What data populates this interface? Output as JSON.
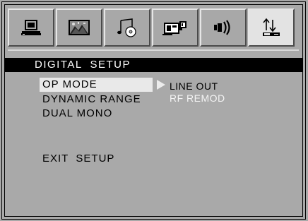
{
  "tabs": [
    {
      "icon": "monitor-icon",
      "active": false
    },
    {
      "icon": "picture-icon",
      "active": false
    },
    {
      "icon": "music-cd-icon",
      "active": false
    },
    {
      "icon": "video-camera-icon",
      "active": false
    },
    {
      "icon": "speaker-icon",
      "active": false
    },
    {
      "icon": "digital-setup-icon",
      "active": true
    }
  ],
  "title": "DIGITAL  SETUP",
  "menu": {
    "op_mode": "OP MODE",
    "dynamic_range": "DYNAMIC RANGE",
    "dual_mono": "DUAL MONO",
    "exit_setup": "EXIT  SETUP"
  },
  "options": {
    "line_out": "LINE OUT",
    "rf_remod": "RF REMOD"
  },
  "colors": {
    "background": "#a9a9a9",
    "title_bar": "#000000",
    "selected_item": "#e9e9e9",
    "active_tab": "#e3e3e3"
  }
}
